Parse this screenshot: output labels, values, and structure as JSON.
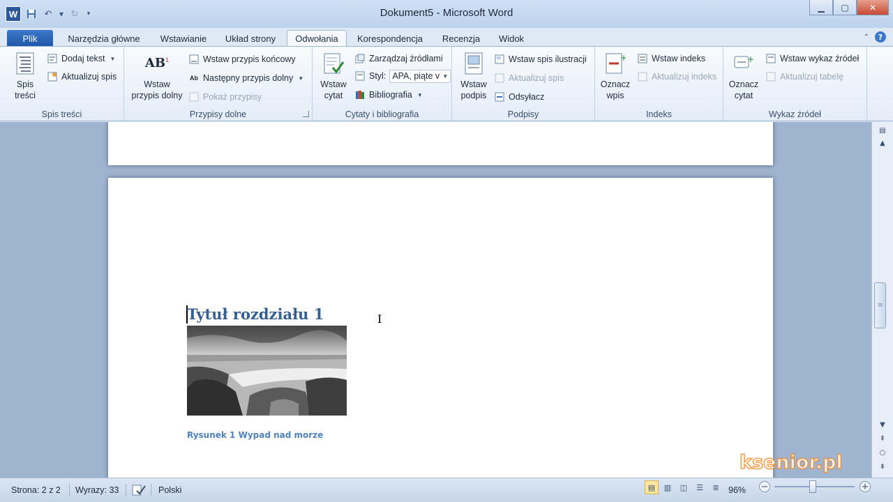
{
  "window": {
    "title": "Dokument5  -  Microsoft Word",
    "app_logo": "W"
  },
  "tabs": [
    {
      "label": "Plik"
    },
    {
      "label": "Narzędzia główne"
    },
    {
      "label": "Wstawianie"
    },
    {
      "label": "Układ strony"
    },
    {
      "label": "Odwołania"
    },
    {
      "label": "Korespondencja"
    },
    {
      "label": "Recenzja"
    },
    {
      "label": "Widok"
    }
  ],
  "ribbon": {
    "toc": {
      "group": "Spis treści",
      "big": "Spis\ntreści",
      "add_text": "Dodaj tekst",
      "update": "Aktualizuj spis"
    },
    "footnotes": {
      "group": "Przypisy dolne",
      "big": "Wstaw\nprzypis dolny",
      "ab_label": "AB",
      "insert_endnote": "Wstaw przypis końcowy",
      "next_footnote": "Następny przypis dolny",
      "show_notes": "Pokaż przypisy"
    },
    "citations": {
      "group": "Cytaty i bibliografia",
      "big": "Wstaw\ncytat",
      "manage": "Zarządzaj źródłami",
      "style_label": "Styl:",
      "style_value": "APA, piąte v",
      "bibliography": "Bibliografia"
    },
    "captions": {
      "group": "Podpisy",
      "big": "Wstaw\npodpis",
      "insert_figures": "Wstaw spis ilustracji",
      "update": "Aktualizuj spis",
      "cross_ref": "Odsyłacz"
    },
    "index": {
      "group": "Indeks",
      "big": "Oznacz\nwpis",
      "insert": "Wstaw indeks",
      "update": "Aktualizuj indeks"
    },
    "authorities": {
      "group": "Wykaz źródeł",
      "big": "Oznacz\ncytat",
      "insert": "Wstaw wykaz źródeł",
      "update": "Aktualizuj tabelę"
    }
  },
  "document": {
    "heading": "Tytuł rozdziału 1",
    "caption": "Rysunek 1 Wypad nad morze"
  },
  "status": {
    "page": "Strona: 2 z 2",
    "words": "Wyrazy: 33",
    "language": "Polski",
    "zoom": "96%",
    "zoom_level": 0.96
  },
  "watermark": "ksenior.pl",
  "colors": {
    "heading": "#365f91",
    "caption": "#4f81bd",
    "file_tab": "#2b5fb4"
  }
}
